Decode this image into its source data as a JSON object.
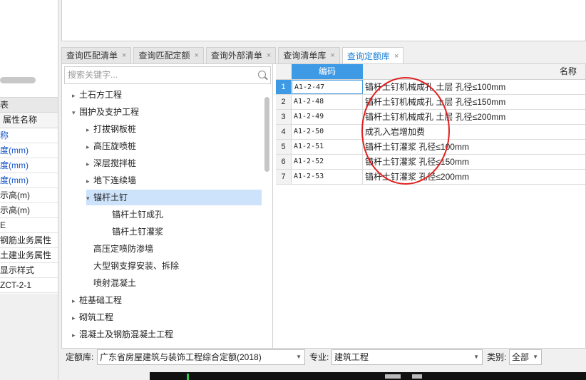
{
  "left_panel": {
    "title": "表",
    "column_header": "属性名称",
    "rows": [
      {
        "label": "称",
        "blue": true
      },
      {
        "label": "度(mm)",
        "blue": true
      },
      {
        "label": "度(mm)",
        "blue": true
      },
      {
        "label": "度(mm)",
        "blue": true
      },
      {
        "label": "示高(m)",
        "blue": false
      },
      {
        "label": "示高(m)",
        "blue": false
      },
      {
        "label": "E",
        "blue": false
      },
      {
        "label": "钢筋业务属性",
        "blue": false
      },
      {
        "label": "土建业务属性",
        "blue": false
      },
      {
        "label": "显示样式",
        "blue": false
      },
      {
        "label": "ZCT-2-1",
        "blue": false
      }
    ]
  },
  "tabs": [
    {
      "label": "查询匹配清单",
      "active": false
    },
    {
      "label": "查询匹配定额",
      "active": false
    },
    {
      "label": "查询外部清单",
      "active": false
    },
    {
      "label": "查询清单库",
      "active": false
    },
    {
      "label": "查询定额库",
      "active": true
    }
  ],
  "tab_close_glyph": "×",
  "search": {
    "placeholder": "搜索关键字..."
  },
  "tree": [
    {
      "label": "土石方工程",
      "level": 0,
      "arrow": "▸",
      "selected": false
    },
    {
      "label": "围护及支护工程",
      "level": 0,
      "arrow": "▾",
      "selected": false
    },
    {
      "label": "打拔钢板桩",
      "level": 1,
      "arrow": "▸",
      "selected": false
    },
    {
      "label": "高压旋喷桩",
      "level": 1,
      "arrow": "▸",
      "selected": false
    },
    {
      "label": "深层搅拌桩",
      "level": 1,
      "arrow": "▸",
      "selected": false
    },
    {
      "label": "地下连续墙",
      "level": 1,
      "arrow": "▸",
      "selected": false
    },
    {
      "label": "锚杆土钉",
      "level": 1,
      "arrow": "▾",
      "selected": true
    },
    {
      "label": "锚杆土钉成孔",
      "level": 2,
      "arrow": "",
      "selected": false
    },
    {
      "label": "锚杆土钉灌浆",
      "level": 2,
      "arrow": "",
      "selected": false
    },
    {
      "label": "高压定喷防渗墙",
      "level": 1,
      "arrow": "",
      "selected": false
    },
    {
      "label": "大型钢支撑安装、拆除",
      "level": 1,
      "arrow": "",
      "selected": false
    },
    {
      "label": "喷射混凝土",
      "level": 1,
      "arrow": "",
      "selected": false
    },
    {
      "label": "桩基础工程",
      "level": 0,
      "arrow": "▸",
      "selected": false
    },
    {
      "label": "砌筑工程",
      "level": 0,
      "arrow": "▸",
      "selected": false
    },
    {
      "label": "混凝土及钢筋混凝土工程",
      "level": 0,
      "arrow": "▸",
      "selected": false
    }
  ],
  "grid": {
    "headers": {
      "code": "编码",
      "name": "名称"
    },
    "rows": [
      {
        "num": "1",
        "code": "A1-2-47",
        "name": "锚杆土钉机械成孔 土层 孔径≤100mm"
      },
      {
        "num": "2",
        "code": "A1-2-48",
        "name": "锚杆土钉机械成孔 土层 孔径≤150mm"
      },
      {
        "num": "3",
        "code": "A1-2-49",
        "name": "锚杆土钉机械成孔 土层 孔径≤200mm"
      },
      {
        "num": "4",
        "code": "A1-2-50",
        "name": "成孔入岩增加费"
      },
      {
        "num": "5",
        "code": "A1-2-51",
        "name": "锚杆土钉灌浆 孔径≤100mm"
      },
      {
        "num": "6",
        "code": "A1-2-52",
        "name": "锚杆土钉灌浆 孔径≤150mm"
      },
      {
        "num": "7",
        "code": "A1-2-53",
        "name": "锚杆土钉灌浆 孔径≤200mm"
      }
    ]
  },
  "footer": {
    "quota_label": "定额库:",
    "quota_value": "广东省房屋建筑与装饰工程综合定额(2018)",
    "specialty_label": "专业:",
    "specialty_value": "建筑工程",
    "category_label": "类别:",
    "category_value": "全部"
  },
  "colors": {
    "accent": "#3f9ae6",
    "tab_active_text": "#1a7fd6",
    "selected_row": "#cde2fb",
    "annotation": "#e02020"
  }
}
